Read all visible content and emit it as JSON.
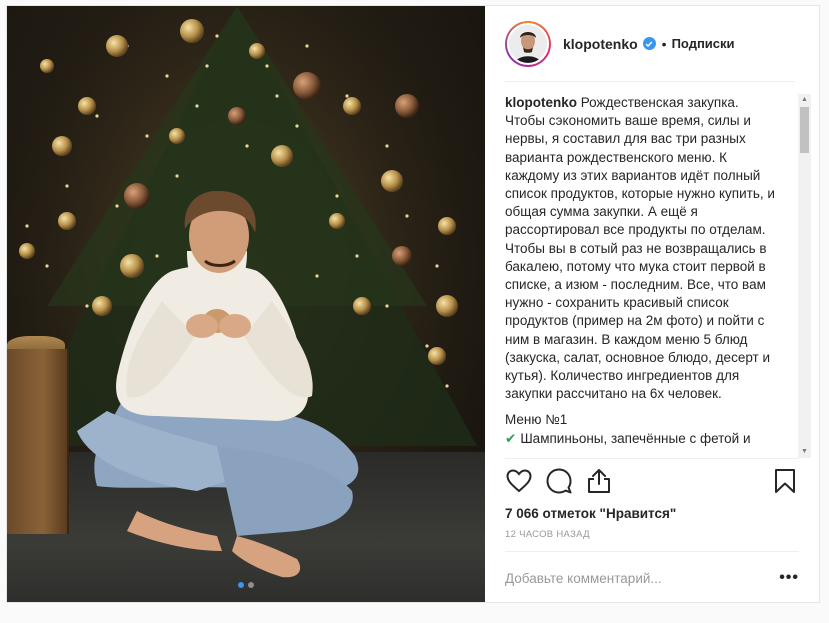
{
  "post": {
    "author": "klopotenko",
    "follow_label": "Подписки",
    "separator": "•",
    "caption_user": "klopotenko",
    "caption_text": " Рождественская закупка. Чтобы сэкономить ваше время, силы и нервы, я составил для вас три разных варианта рождественского меню. К каждому из этих вариантов идёт полный список продуктов, которые нужно купить, и общая сумма закупки. А ещё я рассортировал все продукты по отделам. Чтобы вы в сотый раз не возвращались в бакалею, потому что мука стоит первой в списке, а изюм - последним. Все, что вам нужно - сохранить красивый список продуктов (пример на 2м фото) и пойти с ним в магазин. В каждом меню 5 блюд (закуска, салат, основное блюдо, десерт и кутья). Количество ингредиентов для закупки рассчитано на 6х человек.",
    "menu_title": "Меню №1",
    "menu_item_1": "Шампиньоны, запечённые с фетой и",
    "likes": "7 066 отметок \"Нравится\"",
    "time": "12 ЧАСОВ НАЗАД",
    "comment_placeholder": "Добавьте комментарий...",
    "more_label": "•••",
    "carousel": {
      "count": 2,
      "active": 0
    },
    "colors": {
      "accent": "#3897f0",
      "check": "#1fa84a"
    },
    "icons": [
      "heart-icon",
      "comment-icon",
      "share-icon",
      "bookmark-icon",
      "verified-icon",
      "check-icon",
      "more-icon"
    ]
  }
}
